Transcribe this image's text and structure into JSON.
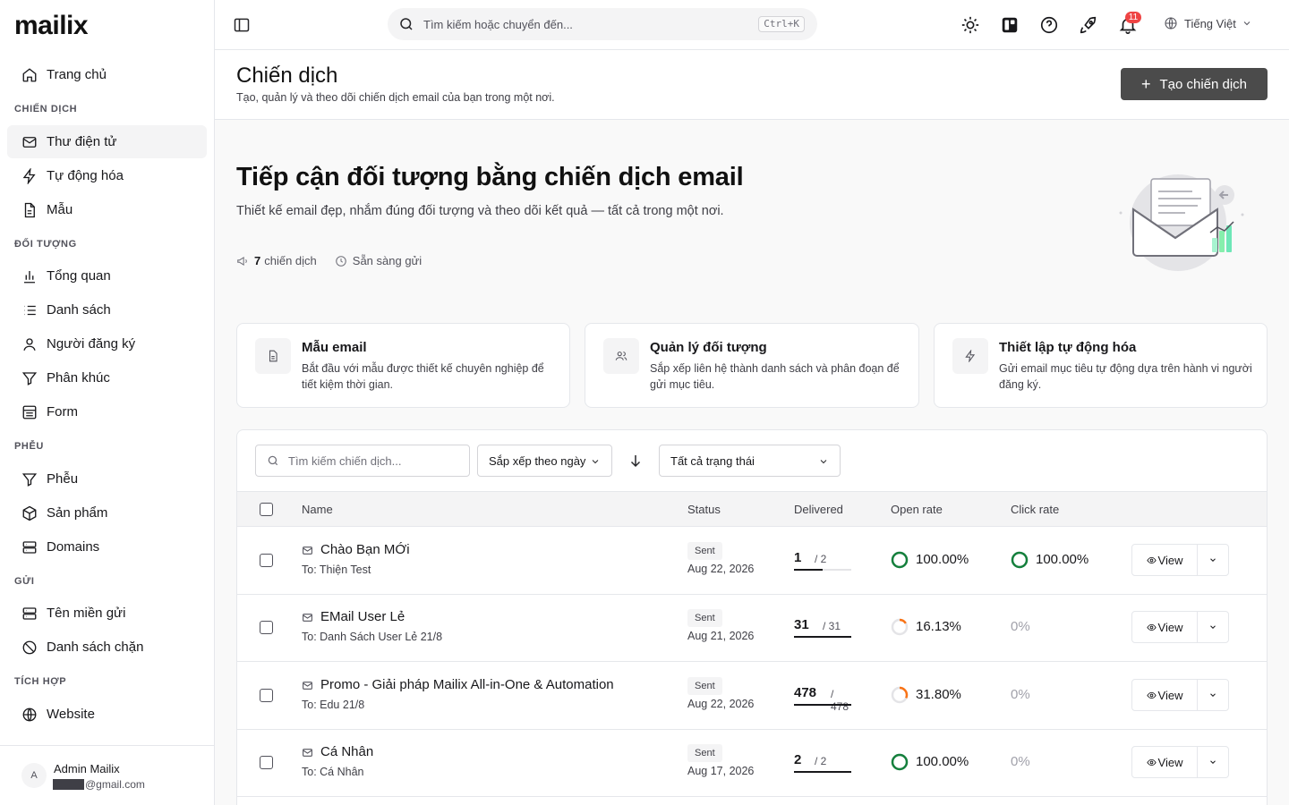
{
  "brand": {
    "logo_text": "mailix"
  },
  "sidebar": {
    "items": [
      {
        "label": "Trang chủ",
        "icon": "home-icon"
      },
      {
        "label": "Thư điện tử",
        "icon": "mail-icon",
        "active": true
      },
      {
        "label": "Tự động hóa",
        "icon": "zap-icon"
      },
      {
        "label": "Mẫu",
        "icon": "file-icon"
      },
      {
        "label": "Tổng quan",
        "icon": "bar-chart-icon"
      },
      {
        "label": "Danh sách",
        "icon": "list-icon"
      },
      {
        "label": "Người đăng ký",
        "icon": "user-icon"
      },
      {
        "label": "Phân khúc",
        "icon": "filter-icon"
      },
      {
        "label": "Form",
        "icon": "form-icon"
      },
      {
        "label": "Phễu",
        "icon": "funnel-icon"
      },
      {
        "label": "Sản phẩm",
        "icon": "box-icon"
      },
      {
        "label": "Domains",
        "icon": "server-icon"
      },
      {
        "label": "Tên miền gửi",
        "icon": "server-icon"
      },
      {
        "label": "Danh sách chặn",
        "icon": "ban-icon"
      },
      {
        "label": "Website",
        "icon": "globe-icon"
      }
    ],
    "sections": [
      "CHIẾN DỊCH",
      "ĐỐI TƯỢNG",
      "PHỄU",
      "GỬI",
      "TÍCH HỢP"
    ],
    "user": {
      "initial": "A",
      "name": "Admin Mailix",
      "email_suffix": "@gmail.com"
    }
  },
  "topbar": {
    "search_placeholder": "Tìm kiếm hoặc chuyển đến...",
    "shortcut": "Ctrl+K",
    "notification_count": "11",
    "language": "Tiếng Việt"
  },
  "page": {
    "title": "Chiến dịch",
    "subtitle": "Tạo, quản lý và theo dõi chiến dịch email của bạn trong một nơi.",
    "create_button": "Tạo chiến dịch"
  },
  "hero": {
    "title": "Tiếp cận đối tượng bằng chiến dịch email",
    "description": "Thiết kế email đẹp, nhắm đúng đối tượng và theo dõi kết quả — tất cả trong một nơi.",
    "campaign_count": "7",
    "campaign_count_label": "chiến dịch",
    "ready_label": "Sẵn sàng gửi"
  },
  "cards": [
    {
      "title": "Mẫu email",
      "desc": "Bắt đầu với mẫu được thiết kế chuyên nghiệp để tiết kiệm thời gian.",
      "icon": "file-icon"
    },
    {
      "title": "Quản lý đối tượng",
      "desc": "Sắp xếp liên hệ thành danh sách và phân đoạn để gửi mục tiêu.",
      "icon": "users-icon"
    },
    {
      "title": "Thiết lập tự động hóa",
      "desc": "Gửi email mục tiêu tự động dựa trên hành vi người đăng ký.",
      "icon": "zap-icon"
    }
  ],
  "table": {
    "search_placeholder": "Tìm kiếm chiến dịch...",
    "sort_label": "Sắp xếp theo ngày",
    "status_filter": "Tất cả trạng thái",
    "columns": {
      "name": "Name",
      "status": "Status",
      "delivered": "Delivered",
      "open_rate": "Open rate",
      "click_rate": "Click rate"
    },
    "view_label": "View",
    "rows": [
      {
        "name": "Chào Bạn MỚi",
        "to": "To: Thiện Test",
        "status": "Sent",
        "date": "Aug 22, 2026",
        "delivered": "1",
        "total": "/ 2",
        "delivered_fraction": 0.5,
        "open_rate": "100.00%",
        "open_value": 1.0,
        "click_rate": "100.00%",
        "click_value": 1.0
      },
      {
        "name": "EMail User Lẻ",
        "to": "To: Danh Sách User Lẻ 21/8",
        "status": "Sent",
        "date": "Aug 21, 2026",
        "delivered": "31",
        "total": "/ 31",
        "delivered_fraction": 1.0,
        "open_rate": "16.13%",
        "open_value": 0.1613,
        "click_rate": "0%",
        "click_value": 0
      },
      {
        "name": "Promo - Giải pháp Mailix All-in-One & Automation",
        "to": "To: Edu 21/8",
        "status": "Sent",
        "date": "Aug 22, 2026",
        "delivered": "478",
        "total": "/ 478",
        "delivered_fraction": 1.0,
        "open_rate": "31.80%",
        "open_value": 0.318,
        "click_rate": "0%",
        "click_value": 0
      },
      {
        "name": "Cá Nhân",
        "to": "To: Cá Nhân",
        "status": "Sent",
        "date": "Aug 17, 2026",
        "delivered": "2",
        "total": "/ 2",
        "delivered_fraction": 1.0,
        "open_rate": "100.00%",
        "open_value": 1.0,
        "click_rate": "0%",
        "click_value": 0
      }
    ]
  },
  "colors": {
    "accent": "#4b4b4b",
    "ring_full": "#15803d",
    "ring_partial": "#f97316",
    "badge": "#ef4444"
  }
}
